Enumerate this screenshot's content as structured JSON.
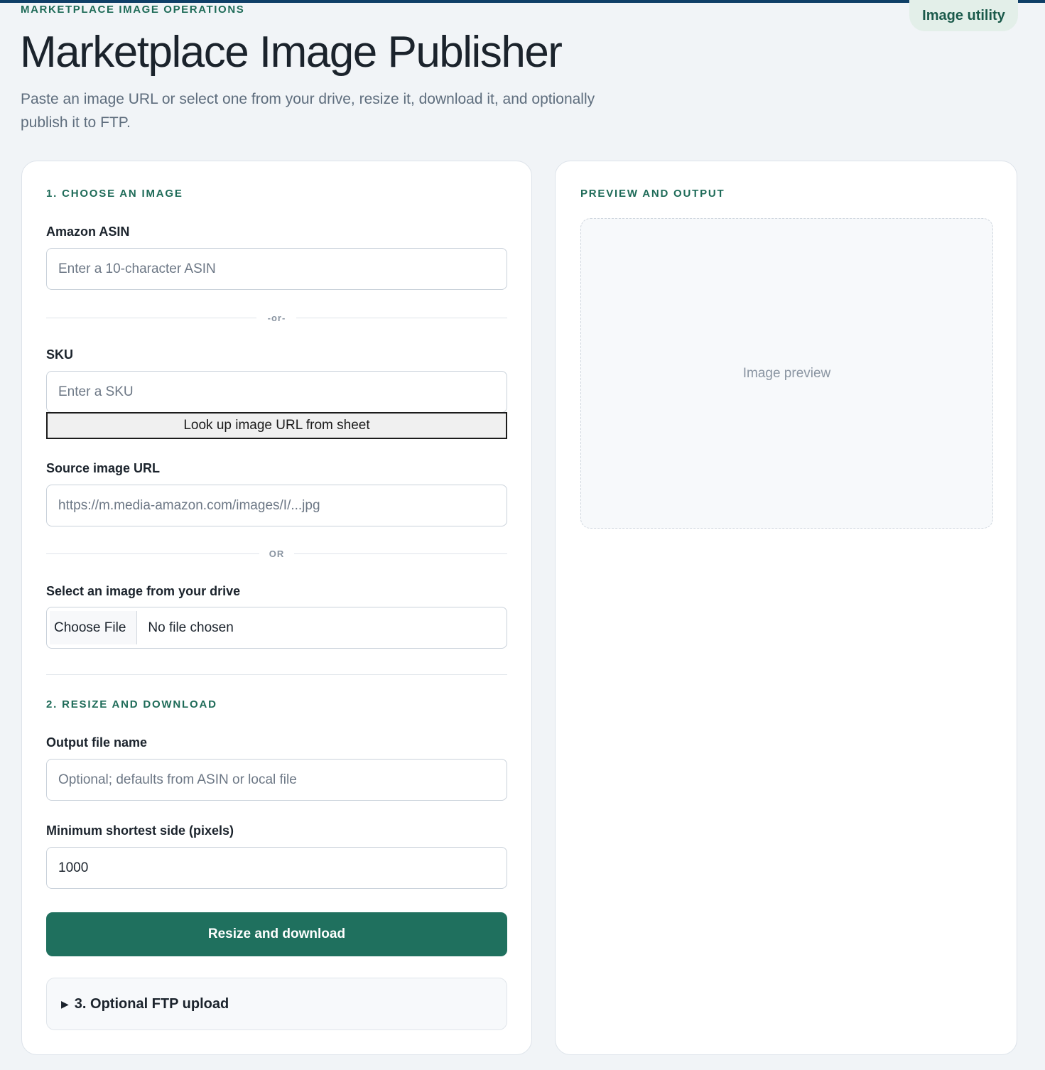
{
  "header": {
    "eyebrow": "MARKETPLACE IMAGE OPERATIONS",
    "badge": "Image utility",
    "title": "Marketplace Image Publisher",
    "subtitle": "Paste an image URL or select one from your drive, resize it, download it, and optionally publish it to FTP."
  },
  "choose": {
    "section_title": "1. CHOOSE AN IMAGE",
    "asin_label": "Amazon ASIN",
    "asin_placeholder": "Enter a 10-character ASIN",
    "or_small": "-or-",
    "sku_label": "SKU",
    "sku_placeholder": "Enter a SKU",
    "lookup_button": "Look up image URL from sheet",
    "url_label": "Source image URL",
    "url_placeholder": "https://m.media-amazon.com/images/I/...jpg",
    "or_big": "OR",
    "drive_label": "Select an image from your drive",
    "choose_file": "Choose File",
    "no_file": "No file chosen"
  },
  "resize": {
    "section_title": "2. RESIZE AND DOWNLOAD",
    "filename_label": "Output file name",
    "filename_placeholder": "Optional; defaults from ASIN or local file",
    "min_side_label": "Minimum shortest side (pixels)",
    "min_side_value": "1000",
    "resize_button": "Resize and download"
  },
  "ftp": {
    "toggle_icon": "triangle-right-icon",
    "label": "3. Optional FTP upload"
  },
  "preview": {
    "section_title": "PREVIEW AND OUTPUT",
    "placeholder": "Image preview"
  },
  "colors": {
    "accent": "#1e6b58",
    "primary_button": "#1f705e",
    "topbar": "#0f3f67",
    "background": "#f1f4f7"
  }
}
